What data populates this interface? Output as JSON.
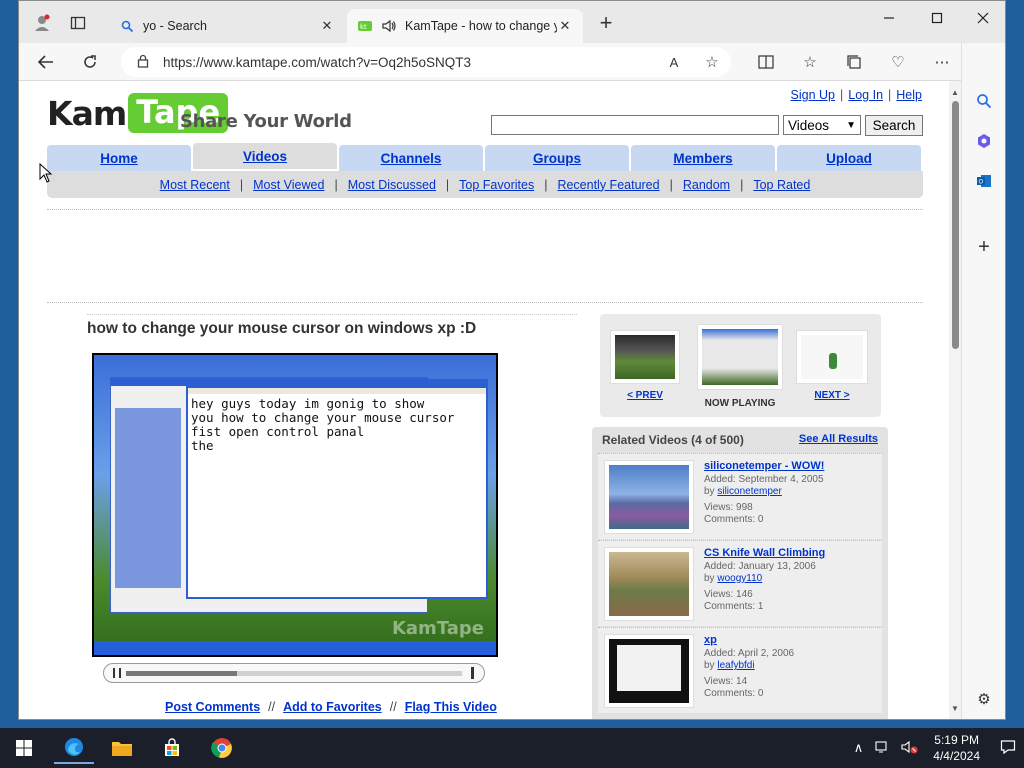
{
  "browser": {
    "tabs": [
      {
        "title": "yo - Search",
        "active": false
      },
      {
        "title": "KamTape - how to change y",
        "active": true
      }
    ],
    "url": "https://www.kamtape.com/watch?v=Oq2h5oSNQT3"
  },
  "site": {
    "logo_kam": "Kam",
    "logo_tape": "Tape",
    "tagline": "Share Your World",
    "toplinks": {
      "signup": "Sign Up",
      "login": "Log In",
      "help": "Help"
    },
    "search": {
      "select_value": "Videos",
      "button": "Search",
      "placeholder": ""
    },
    "nav": [
      "Home",
      "Videos",
      "Channels",
      "Groups",
      "Members",
      "Upload"
    ],
    "nav_active": "Videos",
    "subnav": [
      "Most Recent",
      "Most Viewed",
      "Most Discussed",
      "Top Favorites",
      "Recently Featured",
      "Random",
      "Top Rated"
    ]
  },
  "video": {
    "title": "how to change your mouse cursor on windows xp :D",
    "screen_text": "hey guys today im gonig to show\nyou how to change your mouse cursor\nfist open control panal\nthe",
    "watermark": "KamTape",
    "progress": 0.33,
    "actions": [
      "Post Comments",
      "Add to Favorites",
      "Flag This Video"
    ]
  },
  "now_playing": {
    "prev": "< PREV",
    "current": "NOW PLAYING",
    "next": "NEXT >"
  },
  "related": {
    "heading": "Related Videos (4 of 500)",
    "see_all": "See All Results",
    "items": [
      {
        "title": "siliconetemper - WOW!",
        "added": "Added: September 4, 2005",
        "by_label": "by",
        "by": "siliconetemper",
        "views": "Views: 998",
        "comments": "Comments: 0"
      },
      {
        "title": "CS Knife Wall Climbing",
        "added": "Added: January 13, 2006",
        "by_label": "by",
        "by": "woogy110",
        "views": "Views: 146",
        "comments": "Comments: 1"
      },
      {
        "title": "xp",
        "added": "Added: April 2, 2006",
        "by_label": "by",
        "by": "leafybfdi",
        "views": "Views: 14",
        "comments": "Comments: 0"
      }
    ]
  },
  "taskbar": {
    "time": "5:19 PM",
    "date": "4/4/2024"
  },
  "colors": {
    "link": "#0033cc",
    "nav_tab": "#c7d8f2",
    "logo_green": "#66cc33"
  }
}
